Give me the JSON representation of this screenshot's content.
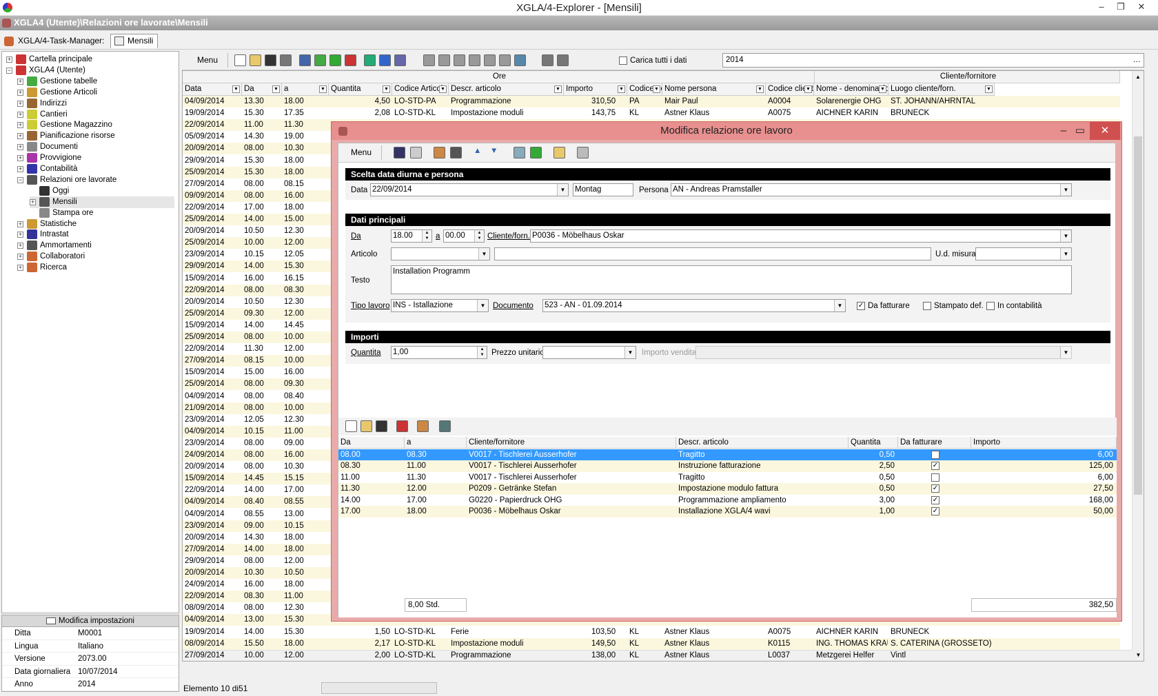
{
  "window": {
    "title": "XGLA/4-Explorer - [Mensili]",
    "path": "XGLA4 (Utente)\\Relazioni ore lavorate\\Mensili"
  },
  "taskbar": {
    "label": "XGLA/4-Task-Manager:",
    "tab": "Mensili"
  },
  "tree": {
    "items": [
      {
        "label": "Cartella principale",
        "level": 0,
        "color": "#c33"
      },
      {
        "label": "XGLA4 (Utente)",
        "level": 0,
        "color": "#c33"
      },
      {
        "label": "Gestione tabelle",
        "level": 1,
        "color": "#4a4"
      },
      {
        "label": "Gestione Articoli",
        "level": 1,
        "color": "#c93"
      },
      {
        "label": "Indirizzi",
        "level": 1,
        "color": "#963"
      },
      {
        "label": "Cantieri",
        "level": 1,
        "color": "#cc3"
      },
      {
        "label": "Gestione Magazzino",
        "level": 1,
        "color": "#cc3"
      },
      {
        "label": "Pianificazione risorse",
        "level": 1,
        "color": "#963"
      },
      {
        "label": "Documenti",
        "level": 1,
        "color": "#888"
      },
      {
        "label": "Provvigione",
        "level": 1,
        "color": "#a3a"
      },
      {
        "label": "Contabilità",
        "level": 1,
        "color": "#33a"
      },
      {
        "label": "Relazioni ore lavorate",
        "level": 1,
        "color": "#555"
      },
      {
        "label": "Oggi",
        "level": 2,
        "color": "#333"
      },
      {
        "label": "Mensili",
        "level": 2,
        "color": "#555"
      },
      {
        "label": "Stampa ore",
        "level": 2,
        "color": "#888"
      },
      {
        "label": "Statistiche",
        "level": 1,
        "color": "#c93"
      },
      {
        "label": "Intrastat",
        "level": 1,
        "color": "#339"
      },
      {
        "label": "Ammortamenti",
        "level": 1,
        "color": "#555"
      },
      {
        "label": "Collaboratori",
        "level": 1,
        "color": "#c63"
      },
      {
        "label": "Ricerca",
        "level": 1,
        "color": "#c63"
      }
    ]
  },
  "props": {
    "header": "Modifica impostazioni",
    "rows": [
      {
        "k": "Ditta",
        "v": "M0001"
      },
      {
        "k": "Lingua",
        "v": "Italiano"
      },
      {
        "k": "Versione",
        "v": "2073.00"
      },
      {
        "k": "Data giornaliera",
        "v": "10/07/2014"
      },
      {
        "k": "Anno",
        "v": "2014"
      }
    ]
  },
  "toolbar": {
    "menu": "Menu",
    "carica": "Carica tutti i dati",
    "year": "2014"
  },
  "grid": {
    "group_ore": "Ore",
    "group_cliente": "Cliente/fornitore",
    "headers": [
      "Data",
      "Da",
      "a",
      "Quantita",
      "Codice Articol",
      "Descr. articolo",
      "Importo",
      "Codice pers",
      "Nome persona",
      "Codice cliente/forn",
      "Nome - denominazione",
      "Luogo cliente/forn."
    ],
    "top_rows": [
      [
        "04/09/2014",
        "13.30",
        "18.00",
        "4,50",
        "LO-STD-PA",
        "Programmazione",
        "310,50",
        "PA",
        "Mair Paul",
        "A0004",
        "Solarenergie OHG",
        "ST. JOHANN/AHRNTAL"
      ],
      [
        "19/09/2014",
        "15.30",
        "17.35",
        "2,08",
        "LO-STD-KL",
        "Impostazione moduli",
        "143,75",
        "KL",
        "Astner Klaus",
        "A0075",
        "AICHNER KARIN",
        "BRUNECK"
      ]
    ],
    "mid_rows": [
      [
        "22/09/2014",
        "11.00",
        "11.30"
      ],
      [
        "05/09/2014",
        "14.30",
        "19.00"
      ],
      [
        "20/09/2014",
        "08.00",
        "10.30"
      ],
      [
        "29/09/2014",
        "15.30",
        "18.00"
      ],
      [
        "25/09/2014",
        "15.30",
        "18.00"
      ],
      [
        "27/09/2014",
        "08.00",
        "08.15"
      ],
      [
        "09/09/2014",
        "08.00",
        "16.00"
      ],
      [
        "22/09/2014",
        "17.00",
        "18.00"
      ],
      [
        "25/09/2014",
        "14.00",
        "15.00"
      ],
      [
        "20/09/2014",
        "10.50",
        "12.30"
      ],
      [
        "25/09/2014",
        "10.00",
        "12.00"
      ],
      [
        "23/09/2014",
        "10.15",
        "12.05"
      ],
      [
        "29/09/2014",
        "14.00",
        "15.30"
      ],
      [
        "15/09/2014",
        "16.00",
        "16.15"
      ],
      [
        "22/09/2014",
        "08.00",
        "08.30"
      ],
      [
        "20/09/2014",
        "10.50",
        "12.30"
      ],
      [
        "25/09/2014",
        "09.30",
        "12.00"
      ],
      [
        "15/09/2014",
        "14.00",
        "14.45"
      ],
      [
        "25/09/2014",
        "08.00",
        "10.00"
      ],
      [
        "22/09/2014",
        "11.30",
        "12.00"
      ],
      [
        "27/09/2014",
        "08.15",
        "10.00"
      ],
      [
        "15/09/2014",
        "15.00",
        "16.00"
      ],
      [
        "25/09/2014",
        "08.00",
        "09.30"
      ],
      [
        "04/09/2014",
        "08.00",
        "08.40"
      ],
      [
        "21/09/2014",
        "08.00",
        "10.00"
      ],
      [
        "23/09/2014",
        "12.05",
        "12.30"
      ],
      [
        "04/09/2014",
        "10.15",
        "11.00"
      ],
      [
        "23/09/2014",
        "08.00",
        "09.00"
      ],
      [
        "24/09/2014",
        "08.00",
        "16.00"
      ],
      [
        "20/09/2014",
        "08.00",
        "10.30"
      ],
      [
        "15/09/2014",
        "14.45",
        "15.15"
      ],
      [
        "22/09/2014",
        "14.00",
        "17.00"
      ],
      [
        "04/09/2014",
        "08.40",
        "08.55"
      ],
      [
        "04/09/2014",
        "08.55",
        "13.00"
      ],
      [
        "23/09/2014",
        "09.00",
        "10.15"
      ],
      [
        "20/09/2014",
        "14.30",
        "18.00"
      ],
      [
        "27/09/2014",
        "14.00",
        "18.00"
      ],
      [
        "29/09/2014",
        "08.00",
        "12.00"
      ],
      [
        "20/09/2014",
        "10.30",
        "10.50"
      ],
      [
        "24/09/2014",
        "16.00",
        "18.00"
      ],
      [
        "22/09/2014",
        "08.30",
        "11.00"
      ],
      [
        "08/09/2014",
        "08.00",
        "12.30"
      ],
      [
        "04/09/2014",
        "13.00",
        "15.30"
      ]
    ],
    "bottom_rows": [
      [
        "19/09/2014",
        "14.00",
        "15.30",
        "1,50",
        "LO-STD-KL",
        "Ferie",
        "103,50",
        "KL",
        "Astner Klaus",
        "A0075",
        "AICHNER KARIN",
        "BRUNECK"
      ],
      [
        "08/09/2014",
        "15.50",
        "18.00",
        "2,17",
        "LO-STD-KL",
        "Impostazione moduli",
        "149,50",
        "KL",
        "Astner Klaus",
        "K0115",
        "ING. THOMAS KRAUSE",
        "S. CATERINA (GROSSETO)"
      ],
      [
        "27/09/2014",
        "10.00",
        "12.00",
        "2,00",
        "LO-STD-KL",
        "Programmazione",
        "138,00",
        "KL",
        "Astner Klaus",
        "L0037",
        "Metzgerei Helfer",
        "Vintl"
      ]
    ]
  },
  "status": {
    "text": "Elemento 10 di51"
  },
  "dialog": {
    "title": "Modifica relazione ore lavoro",
    "menu": "Menu",
    "sec1": "Scelta data diurna e persona",
    "data_label": "Data",
    "data_value": "22/09/2014",
    "weekday": "Montag",
    "persona_label": "Persona",
    "persona_value": "AN - Andreas Pramstaller",
    "sec2": "Dati principali",
    "da_label": "Da",
    "da_value": "18.00",
    "a_label": "a",
    "a_value": "00.00",
    "cliente_label": "Cliente/forn.",
    "cliente_value": "P0036 - Möbelhaus Oskar",
    "articolo_label": "Articolo",
    "articolo_value": "",
    "articolo_desc": "",
    "udm_label": "U.d. misura",
    "udm_value": "",
    "testo_label": "Testo",
    "testo_value": "Installation Programm",
    "tipo_label": "Tipo lavoro",
    "tipo_value": "INS - Istallazione",
    "documento_label": "Documento",
    "documento_value": "523 - AN - 01.09.2014",
    "da_fatturare": "Da fatturare",
    "stampato": "Stampato def.",
    "in_contabilita": "In contabilità",
    "sec3": "Importi",
    "quantita_label": "Quantita",
    "quantita_value": "1,00",
    "prezzo_label": "Prezzo unitario",
    "prezzo_value": "",
    "importo_label": "Importo vendita",
    "importo_value": "",
    "sub_headers": [
      "Da",
      "a",
      "Cliente/fornitore",
      "Descr. articolo",
      "Quantita",
      "Da fatturare",
      "Importo"
    ],
    "sub_rows": [
      {
        "da": "08.00",
        "a": "08.30",
        "cliente": "V0017 - Tischlerei Ausserhofer",
        "descr": "Tragitto",
        "qta": "0,50",
        "fatt": false,
        "imp": "6,00"
      },
      {
        "da": "08.30",
        "a": "11.00",
        "cliente": "V0017 - Tischlerei Ausserhofer",
        "descr": "Instruzione fatturazione",
        "qta": "2,50",
        "fatt": true,
        "imp": "125,00"
      },
      {
        "da": "11.00",
        "a": "11.30",
        "cliente": "V0017 - Tischlerei Ausserhofer",
        "descr": "Tragitto",
        "qta": "0,50",
        "fatt": false,
        "imp": "6,00"
      },
      {
        "da": "11.30",
        "a": "12.00",
        "cliente": "P0209 - Getränke Stefan",
        "descr": "Impostazione modulo fattura",
        "qta": "0,50",
        "fatt": true,
        "imp": "27,50"
      },
      {
        "da": "14.00",
        "a": "17.00",
        "cliente": "G0220 - Papierdruck OHG",
        "descr": "Programmazione ampliamento",
        "qta": "3,00",
        "fatt": true,
        "imp": "168,00"
      },
      {
        "da": "17.00",
        "a": "18.00",
        "cliente": "P0036 - Möbelhaus Oskar",
        "descr": "Installazione  XGLA/4 wavi",
        "qta": "1,00",
        "fatt": true,
        "imp": "50,00"
      }
    ],
    "footer_hours": "8,00 Std.",
    "footer_total": "382,50"
  }
}
